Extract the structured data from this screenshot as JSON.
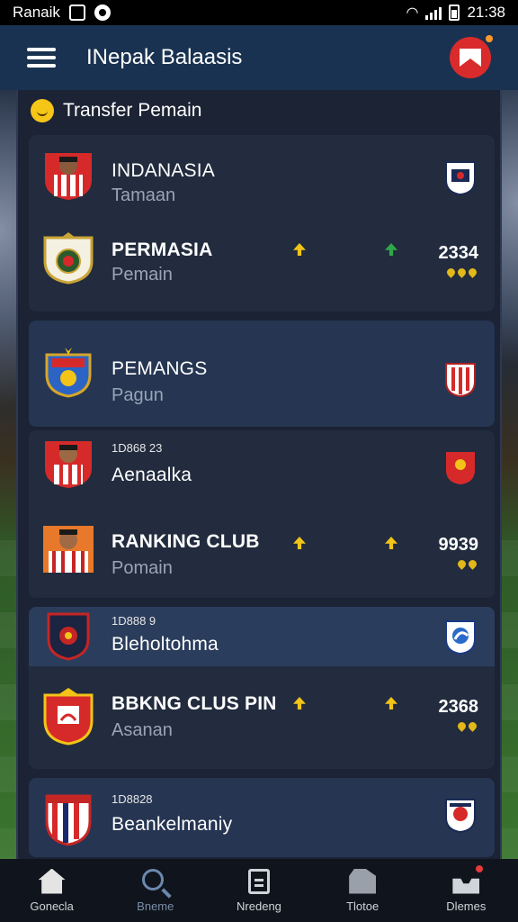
{
  "status_bar": {
    "carrier": "Ranaik",
    "time": "21:38"
  },
  "header": {
    "title": "INepak Balaasis"
  },
  "section": {
    "title": "Transfer Pemain"
  },
  "cards": [
    {
      "rows": [
        {
          "name": "INDANASIA",
          "sub": "Tamaan"
        },
        {
          "name": "PERMASIA",
          "sub": "Pemain",
          "score": "2334"
        }
      ]
    },
    {
      "rows": [
        {
          "name": "PEMANGS",
          "sub": "Pagun"
        }
      ]
    },
    {
      "rows": [
        {
          "code": "1D868 23",
          "name": "Aenaalka"
        },
        {
          "name": "RANKING CLUB",
          "sub": "Pomain",
          "score": "9939"
        }
      ]
    },
    {
      "rows": [
        {
          "code": "1D888 9",
          "name": "Bleholtohma"
        },
        {
          "name": "BBKNG CLUS PIN",
          "sub": "Asanan",
          "score": "2368"
        }
      ]
    },
    {
      "rows": [
        {
          "code": "1D8828",
          "name": "Beankelmaniy"
        }
      ]
    }
  ],
  "nav": [
    {
      "label": "Gonecla",
      "icon": "home-icon"
    },
    {
      "label": "Bneme",
      "icon": "search-icon"
    },
    {
      "label": "Nredeng",
      "icon": "document-icon"
    },
    {
      "label": "Tlotoe",
      "icon": "box-icon"
    },
    {
      "label": "Dlemes",
      "icon": "inbox-icon"
    }
  ],
  "colors": {
    "header": "#1a3251",
    "panel": "#1b2334",
    "accent_red": "#d92b2b",
    "arrow_yellow": "#f2c418",
    "arrow_green": "#2fa84a"
  }
}
